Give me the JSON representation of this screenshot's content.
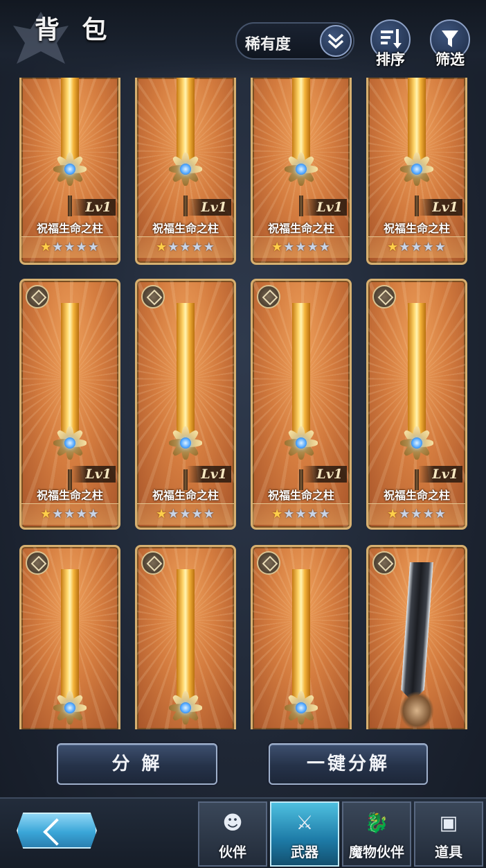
{
  "header": {
    "title": "背 包",
    "rarity_label": "稀有度",
    "sort_label": "排序",
    "filter_label": "筛选"
  },
  "items": [
    {
      "level": "Lv1",
      "name": "祝福生命之柱",
      "stars_filled": 1,
      "stars_total": 5,
      "type": "gold"
    },
    {
      "level": "Lv1",
      "name": "祝福生命之柱",
      "stars_filled": 1,
      "stars_total": 5,
      "type": "gold"
    },
    {
      "level": "Lv1",
      "name": "祝福生命之柱",
      "stars_filled": 1,
      "stars_total": 5,
      "type": "gold"
    },
    {
      "level": "Lv1",
      "name": "祝福生命之柱",
      "stars_filled": 1,
      "stars_total": 5,
      "type": "gold"
    },
    {
      "level": "Lv1",
      "name": "祝福生命之柱",
      "stars_filled": 1,
      "stars_total": 5,
      "type": "gold"
    },
    {
      "level": "Lv1",
      "name": "祝福生命之柱",
      "stars_filled": 1,
      "stars_total": 5,
      "type": "gold"
    },
    {
      "level": "Lv1",
      "name": "祝福生命之柱",
      "stars_filled": 1,
      "stars_total": 5,
      "type": "gold"
    },
    {
      "level": "Lv1",
      "name": "祝福生命之柱",
      "stars_filled": 1,
      "stars_total": 5,
      "type": "gold"
    },
    {
      "type": "gold"
    },
    {
      "type": "gold"
    },
    {
      "type": "gold"
    },
    {
      "type": "dark"
    }
  ],
  "actions": {
    "decompose": "分 解",
    "decompose_all": "一键分解"
  },
  "nav": {
    "tabs": [
      {
        "label": "伙伴",
        "icon": "partner-icon",
        "active": false
      },
      {
        "label": "武器",
        "icon": "weapon-icon",
        "active": true
      },
      {
        "label": "魔物伙伴",
        "icon": "monster-icon",
        "active": false
      },
      {
        "label": "道具",
        "icon": "item-icon",
        "active": false
      }
    ]
  }
}
